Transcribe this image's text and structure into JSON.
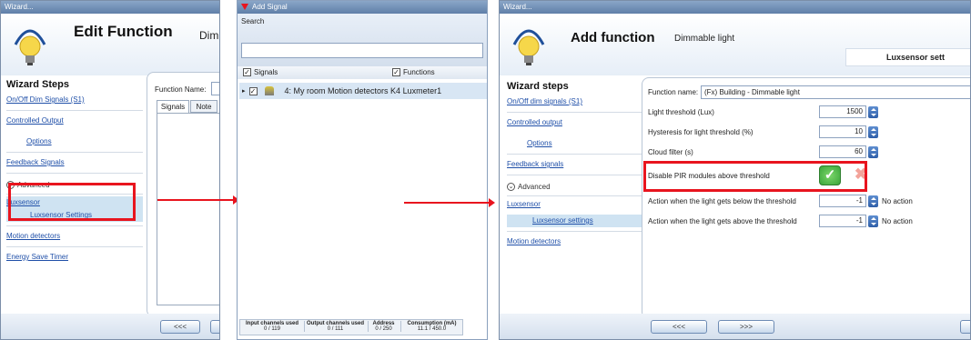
{
  "left": {
    "titlebar": "Wizard...",
    "title": "Edit Function",
    "subtitle": "Dim",
    "steps_title": "Wizard Steps",
    "steps": [
      "On/Off Dim Signals (S1)",
      "Controlled Output",
      "Options",
      "Feedback Signals"
    ],
    "advanced": "Advanced",
    "steps2": [
      "Luxsensor",
      "Luxsensor Settings",
      "Motion detectors",
      "Energy Save Timer"
    ],
    "function_name_label": "Function Name:",
    "tabs": [
      "Signals",
      "Note"
    ],
    "back_button": "<<<"
  },
  "middle": {
    "titlebar": "Add Signal",
    "search_label": "Search",
    "signals_check": "Signals",
    "functions_check": "Functions",
    "signal_row": "4: My room Motion detectors K4 Luxmeter1",
    "status_headers": [
      "Input channels used",
      "Output channels used",
      "Address",
      "Consumption (mA)"
    ],
    "status_values": [
      "0 / 119",
      "0 / 111",
      "0 / 250",
      "11.1 / 450.0"
    ]
  },
  "right": {
    "titlebar": "Wizard...",
    "title": "Add function",
    "subtitle": "Dimmable light",
    "tab_title": "Luxsensor sett",
    "steps_title": "Wizard steps",
    "steps": [
      "On/Off dim signals (S1)",
      "Controlled output",
      "Options",
      "Feedback signals"
    ],
    "advanced": "Advanced",
    "steps2": [
      "Luxsensor",
      "Luxsensor settings",
      "Motion detectors"
    ],
    "function_name_label": "Function name:",
    "function_name_value": "(Fx) Building - Dimmable light",
    "light_threshold_label": "Light threshold (Lux)",
    "light_threshold_value": "1500",
    "hysteresis_label": "Hysteresis for light threshold (%)",
    "hysteresis_value": "10",
    "cloud_label": "Cloud filter (s)",
    "cloud_value": "60",
    "disable_pir_label": "Disable PIR modules above threshold",
    "below_label": "Action when the light gets below the threshold",
    "below_value": "-1",
    "below_action": "No action",
    "above_label": "Action when the light gets above the threshold",
    "above_value": "-1",
    "above_action": "No action",
    "back_button": "<<<",
    "next_button": ">>>"
  },
  "colors": {
    "highlight": "#e8141e",
    "accent": "#1f4fa8",
    "ok": "#3aa63a"
  }
}
